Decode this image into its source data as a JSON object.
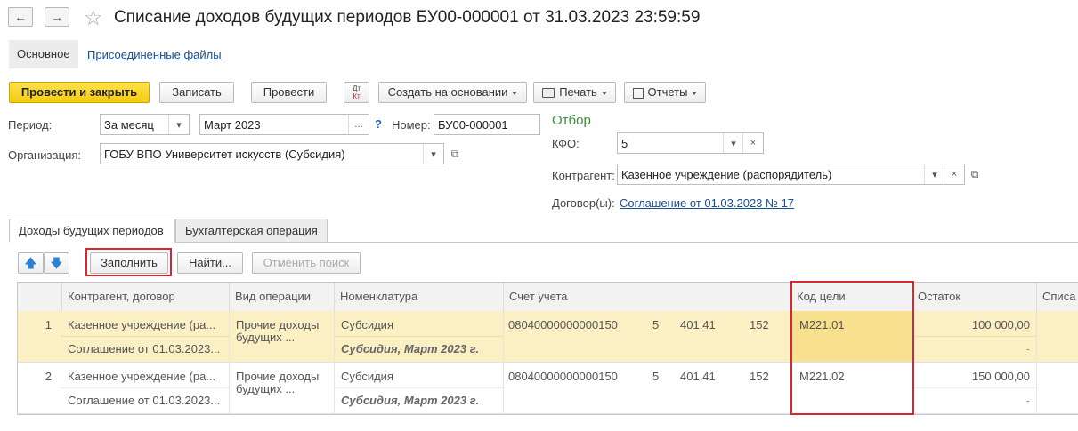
{
  "header": {
    "title": "Списание доходов будущих периодов БУ00-000001 от 31.03.2023 23:59:59",
    "nav_back": "←",
    "nav_forward": "→",
    "star": "☆"
  },
  "top_tabs": {
    "main": "Основное",
    "attached": "Присоединенные файлы"
  },
  "toolbar": {
    "post_close": "Провести и закрыть",
    "save": "Записать",
    "post": "Провести",
    "dtkt_top": "Дт",
    "dtkt_bottom": "Кт",
    "create_based": "Создать на основании",
    "print": "Печать",
    "reports": "Отчеты"
  },
  "form": {
    "period_label": "Период:",
    "period_type": "За месяц",
    "period_value": "Март 2023",
    "period_select": "...",
    "help": "?",
    "number_label": "Номер:",
    "number_value": "БУ00-000001",
    "org_label": "Организация:",
    "org_value": "ГОБУ ВПО Университет искусств (Субсидия)"
  },
  "filter": {
    "title": "Отбор",
    "kfo_label": "КФО:",
    "kfo_value": "5",
    "counterparty_label": "Контрагент:",
    "counterparty_value": "Казенное учреждение (распорядитель)",
    "contract_label": "Договор(ы):",
    "contract_value": "Соглашение от 01.03.2023 № 17"
  },
  "tabs": {
    "income": "Доходы будущих периодов",
    "accounting": "Бухгалтерская операция"
  },
  "table_toolbar": {
    "fill": "Заполнить",
    "find": "Найти...",
    "cancel_search": "Отменить поиск"
  },
  "table": {
    "headers": {
      "counterparty": "Контрагент, договор",
      "operation": "Вид операции",
      "nomenclature": "Номенклатура",
      "account": "Счет учета",
      "goal_code": "Код цели",
      "balance": "Остаток",
      "written_off": "Списа"
    },
    "rows": [
      {
        "n": "1",
        "counterparty": "Казенное учреждение (ра...",
        "contract": "Соглашение от 01.03.2023...",
        "operation_1": "Прочие доходы",
        "operation_2": "будущих ...",
        "nomenclature": "Субсидия",
        "nomenclature_sub": "Субсидия, Март 2023 г.",
        "kbk": "08040000000000150",
        "kfo": "5",
        "account": "401.41",
        "kosgu": "152",
        "goal_code": "М221.01",
        "balance": "100 000,00",
        "dash": "-"
      },
      {
        "n": "2",
        "counterparty": "Казенное учреждение (ра...",
        "contract": "Соглашение от 01.03.2023...",
        "operation_1": "Прочие доходы",
        "operation_2": "будущих ...",
        "nomenclature": "Субсидия",
        "nomenclature_sub": "Субсидия, Март 2023 г.",
        "kbk": "08040000000000150",
        "kfo": "5",
        "account": "401.41",
        "kosgu": "152",
        "goal_code": "М221.02",
        "balance": "150 000,00",
        "dash": "-"
      }
    ]
  }
}
